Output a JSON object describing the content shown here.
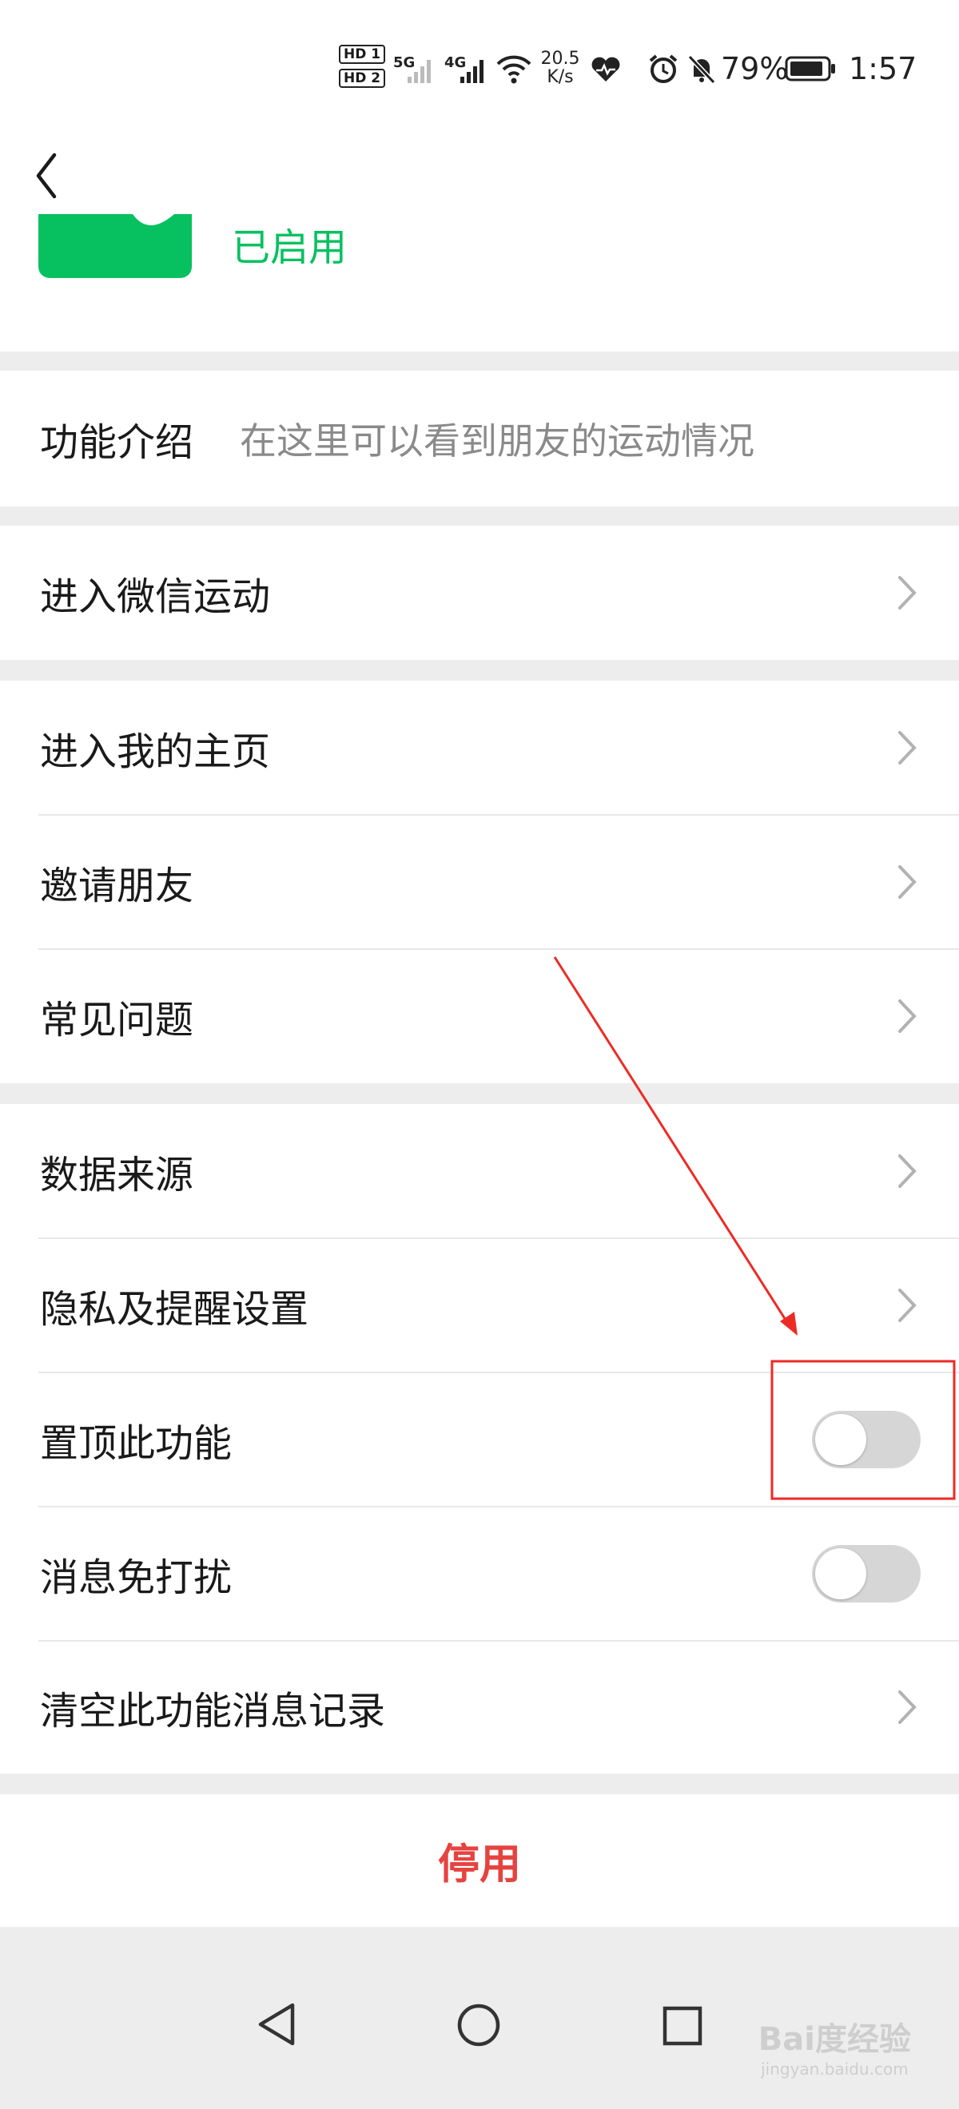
{
  "status_bar": {
    "hd1": "HD 1",
    "hd2": "HD 2",
    "net5g": "5G",
    "net4g": "4G",
    "speed_value": "20.5",
    "speed_unit": "K/s",
    "battery_pct": "79%",
    "time": "1:57"
  },
  "header": {
    "back_icon": "chevron-left-icon",
    "status_text": "已启用",
    "accent_color": "#07c160"
  },
  "intro": {
    "label": "功能介绍",
    "value": "在这里可以看到朋友的运动情况"
  },
  "rows": {
    "enter_sport": "进入微信运动",
    "my_home": "进入我的主页",
    "invite": "邀请朋友",
    "faq": "常见问题",
    "data_source": "数据来源",
    "privacy": "隐私及提醒设置",
    "pin_top": "置顶此功能",
    "mute": "消息免打扰",
    "clear_history": "清空此功能消息记录"
  },
  "toggles": {
    "pin_top_on": false,
    "mute_on": false
  },
  "disable": {
    "label": "停用",
    "color": "#e64340"
  },
  "watermark": {
    "brand": "Bai度经验",
    "url": "jingyan.baidu.com"
  }
}
